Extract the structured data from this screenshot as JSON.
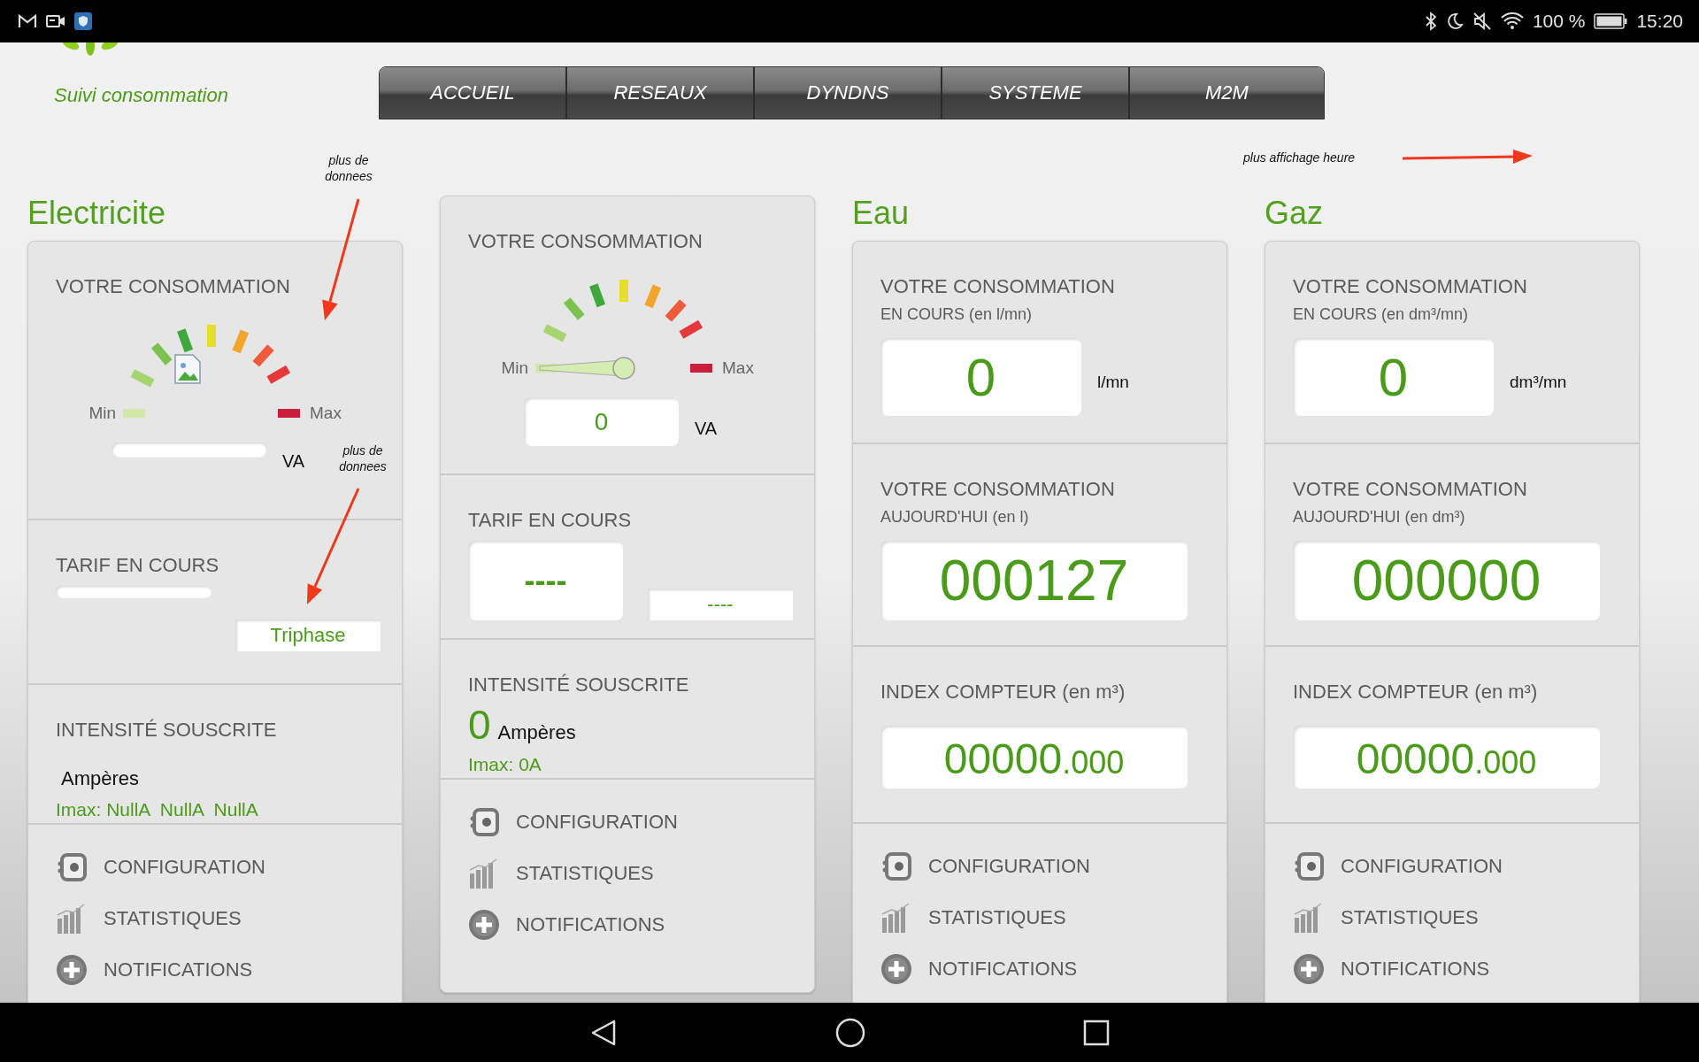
{
  "status_bar": {
    "battery": "100 %",
    "time": "15:20"
  },
  "brand": {
    "subtitle": "Suivi consommation"
  },
  "tabs": [
    {
      "label": "ACCUEIL",
      "selected": false
    },
    {
      "label": "RESEAUX",
      "selected": false
    },
    {
      "label": "DYNDNS",
      "selected": false
    },
    {
      "label": "SYSTEME",
      "selected": false
    },
    {
      "label": "M2M",
      "selected": false
    }
  ],
  "annotations": [
    {
      "text": "plus de donnees"
    },
    {
      "text": "plus affichage heure"
    },
    {
      "text": "plus de donnees"
    }
  ],
  "panels": [
    {
      "heading": "Electricite",
      "sections": [
        {
          "kind": "gauge",
          "title": "VOTRE CONSOMMATION",
          "min_label": "Min",
          "max_label": "Max",
          "unit": "VA",
          "needle": false,
          "image_broken": true
        },
        {
          "kind": "tarif",
          "title": "TARIF EN COURS",
          "secondary": "Triphase"
        },
        {
          "kind": "intensity",
          "title": "INTENSITÉ SOUSCRITE",
          "unit": "Ampères",
          "imax": "Imax: NullA  NullA  NullA"
        }
      ],
      "menu": [
        {
          "kind": "config",
          "label": "CONFIGURATION"
        },
        {
          "kind": "stats",
          "label": "STATISTIQUES"
        },
        {
          "kind": "notify",
          "label": "NOTIFICATIONS"
        }
      ]
    },
    {
      "sections": [
        {
          "kind": "gauge",
          "title": "VOTRE CONSOMMATION",
          "min_label": "Min",
          "max_label": "Max",
          "value": "0",
          "unit": "VA",
          "needle": true,
          "image_broken": false
        },
        {
          "kind": "tarif",
          "title": "TARIF EN COURS",
          "main": "----",
          "secondary": "----"
        },
        {
          "kind": "intensity",
          "title": "INTENSITÉ SOUSCRITE",
          "value": "0",
          "unit": "Ampères",
          "imax": "Imax: 0A"
        }
      ],
      "menu": [
        {
          "kind": "config",
          "label": "CONFIGURATION"
        },
        {
          "kind": "stats",
          "label": "STATISTIQUES"
        },
        {
          "kind": "notify",
          "label": "NOTIFICATIONS"
        }
      ]
    },
    {
      "heading": "Eau",
      "sections": [
        {
          "kind": "reading",
          "title": "VOTRE CONSOMMATION",
          "subtitle": "EN COURS (en l/mn)",
          "value": "0",
          "unit": "l/mn"
        },
        {
          "kind": "reading",
          "title": "VOTRE CONSOMMATION",
          "subtitle": "AUJOURD'HUI (en l)",
          "value": "000127"
        },
        {
          "kind": "index",
          "title": "INDEX COMPTEUR (en m³)",
          "integer": "00000",
          "decimal": ".000"
        }
      ],
      "menu": [
        {
          "kind": "config",
          "label": "CONFIGURATION"
        },
        {
          "kind": "stats",
          "label": "STATISTIQUES"
        },
        {
          "kind": "notify",
          "label": "NOTIFICATIONS"
        }
      ]
    },
    {
      "heading": "Gaz",
      "sections": [
        {
          "kind": "reading",
          "title": "VOTRE CONSOMMATION",
          "subtitle": "EN COURS (en dm³/mn)",
          "value": "0",
          "unit": "dm³/mn"
        },
        {
          "kind": "reading",
          "title": "VOTRE CONSOMMATION",
          "subtitle": "AUJOURD'HUI (en dm³)",
          "value": "000000"
        },
        {
          "kind": "index",
          "title": "INDEX COMPTEUR (en m³)",
          "integer": "00000",
          "decimal": ".000"
        }
      ],
      "menu": [
        {
          "kind": "config",
          "label": "CONFIGURATION"
        },
        {
          "kind": "stats",
          "label": "STATISTIQUES"
        },
        {
          "kind": "notify",
          "label": "NOTIFICATIONS"
        }
      ]
    }
  ]
}
